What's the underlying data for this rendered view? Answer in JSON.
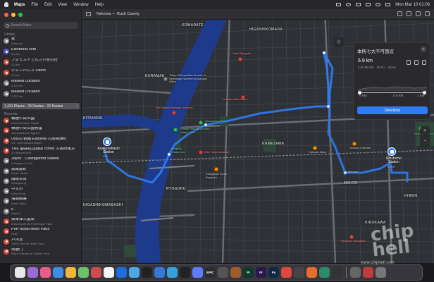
{
  "menubar": {
    "app": "Maps",
    "items": [
      "File",
      "Edit",
      "View",
      "Window",
      "Help"
    ],
    "clock": "Mon Mar 10  01:06"
  },
  "toolbar": {
    "title": "Nekoma — Rush County"
  },
  "sidebar": {
    "search_placeholder": "Search Maps",
    "library_heading": "Library",
    "library": [
      {
        "title": "家",
        "subtitle": "Close by",
        "color": "#8e8e93"
      },
      {
        "title": "Electronic Arts",
        "subtitle": "5.9 km",
        "color": "#5856d6"
      },
      {
        "title": "ブレミストでんざい宮の社",
        "subtitle": "2.2 km",
        "color": "#e0483e"
      },
      {
        "title": "グレンパレス Okino",
        "subtitle": "4.3 km",
        "color": "#e0483e"
      },
      {
        "title": "Marked Location",
        "subtitle": "2,226 km",
        "color": "#8e8e93"
      },
      {
        "title": "Marked Location",
        "subtitle": "2,225 km",
        "color": "#8e8e93"
      }
    ],
    "selected": "1,431 Places · 29 Routes · 22 Routes",
    "recents_heading": "Recents",
    "recents": [
      {
        "title": "模造中央公園",
        "subtitle": "Nekoma Ward, Osaka",
        "color": "#e0483e"
      },
      {
        "title": "模造中央公園预留",
        "subtitle": "Tachibanadori-Higashi",
        "color": "#e0483e"
      },
      {
        "title": "UN/20 數碼 Express-大阪梅澤町",
        "subtitle": "1-1, Umemitsuhonmachi",
        "color": "#e0483e"
      },
      {
        "title": "THE 最高在団酒店 comic 大阪府東京",
        "subtitle": "2-3 Marunouchi",
        "color": "#e0483e"
      },
      {
        "title": "Joyce · Collingwood Station",
        "subtitle": "Collingwood, VIC",
        "color": "#8e8e93"
      },
      {
        "title": "高尾尾町",
        "subtitle": "Ikeda, Osaka",
        "color": "#8e8e93"
      },
      {
        "title": "順德名合",
        "subtitle": "Guangdong",
        "color": "#8e8e93"
      },
      {
        "title": "中文市",
        "subtitle": "Hong Kong",
        "color": "#8e8e93"
      },
      {
        "title": "海城図書",
        "subtitle": "Kanto Ward",
        "color": "#8e8e93"
      },
      {
        "title": "6",
        "subtitle": "Ward 6",
        "color": "#8e8e93"
      },
      {
        "title": "巣栗津三国店",
        "subtitle": "8 Boulevard de Port-Royal, Paris",
        "color": "#e0483e"
      },
      {
        "title": "Port Royal Hotel Paris",
        "subtitle": "Paris",
        "color": "#e0483e"
      },
      {
        "title": "卢浮宫",
        "subtitle": "75001 Rue de Rivoli, Paris",
        "color": "#e0483e"
      },
      {
        "title": "凯旋门",
        "subtitle": "Place Charles de Gaulle, Paris",
        "color": "#e0483e"
      }
    ]
  },
  "map": {
    "districts": [
      "KOMADATE",
      "HIGASHIKOMADA",
      "KURAMAE",
      "KITAHIDAI",
      "KAMEZAWA",
      "MIDORI",
      "RYOGOKU",
      "HIGASHIKOMABASHI",
      "KIKUKAWA",
      "KINSHI"
    ],
    "places": [
      {
        "name": "Tokyo Metropolitan Bureau of Sewerage Northern Sewerage Office",
        "kind": "gray"
      },
      {
        "name": "The Sumida Hokusai Museum",
        "kind": "red"
      },
      {
        "name": "Former Yasuda Garden Water Gate",
        "kind": "green"
      },
      {
        "name": "Yokoamicho Park",
        "kind": "green"
      },
      {
        "name": "Ryogoku Sekaridome",
        "kind": "green"
      },
      {
        "name": "Edo-Tokyo Museum",
        "kind": "red"
      },
      {
        "name": "Kokugikan Sumo Ryogoku",
        "kind": "orange"
      },
      {
        "name": "RYOGOKU",
        "kind": "label"
      },
      {
        "name": "Hokusai Sabo",
        "kind": "orange"
      },
      {
        "name": "Sumida Chardan",
        "kind": "orange"
      },
      {
        "name": "Edo-Saaki Yokaichi",
        "kind": "red"
      },
      {
        "name": "Kinshicho Park",
        "kind": "green"
      },
      {
        "name": "Hotel Ryogoku",
        "kind": "red"
      },
      {
        "name": "Yamada Machidaya",
        "kind": "red"
      },
      {
        "name": "Kotobashi",
        "kind": "label"
      },
      {
        "name": "Kinshicho Ward",
        "kind": "label"
      },
      {
        "name": "Ryogoku Kokugikan",
        "kind": "red"
      }
    ],
    "start_station": {
      "name": "Asakusabashi Station",
      "tag": "END"
    },
    "end_station": {
      "name": "Kinshicho Station",
      "tag": "START"
    },
    "route_color": "#2f7cf6"
  },
  "directions_card": {
    "title": "本所七大不可思议",
    "distance": "5.9 km",
    "duration": "1 hr 25 min · 10 m↑ · 10 m↓",
    "km_start": "0 KM",
    "km_mid": "0.6 KM",
    "km_end": "1 KM",
    "button": "Directions"
  },
  "dock": {
    "apps": [
      {
        "label": "",
        "color": "#e8e8ec"
      },
      {
        "label": "",
        "color": "#9a6bd8"
      },
      {
        "label": "",
        "color": "#e85d8a"
      },
      {
        "label": "",
        "color": "#3a8ee6"
      },
      {
        "label": "",
        "color": "#f5b53b"
      },
      {
        "label": "",
        "color": "#6cc26c"
      },
      {
        "label": "",
        "color": "#d04c4c"
      },
      {
        "label": "10",
        "color": "#f4f4f4"
      },
      {
        "label": "",
        "color": "#1d6ddf"
      },
      {
        "label": "",
        "color": "#4ea8e8"
      },
      {
        "label": "",
        "color": "#222"
      },
      {
        "label": "",
        "color": "#3478d8"
      },
      {
        "label": "",
        "color": "#36a0e0"
      },
      {
        "label": "",
        "color": "#222"
      },
      {
        "label": "",
        "color": "#5c7cfa"
      },
      {
        "label": "EPIC",
        "color": "#2b2b2b"
      },
      {
        "label": "",
        "color": "#555"
      },
      {
        "label": "",
        "color": "#a05a2c"
      },
      {
        "label": "Pt",
        "color": "#0e3a2e"
      },
      {
        "label": "Pr",
        "color": "#2b1a49"
      },
      {
        "label": "Ps",
        "color": "#0b2a4a"
      },
      {
        "label": "",
        "color": "#e0483e"
      },
      {
        "label": "",
        "color": "#444"
      },
      {
        "label": "",
        "color": "#e66d2e"
      },
      {
        "label": "",
        "color": "#2a8a6a"
      },
      {
        "label": "",
        "color": "#333"
      },
      {
        "label": "",
        "color": "#666"
      },
      {
        "label": "",
        "color": "#c23b3b"
      },
      {
        "label": "",
        "color": "#777"
      }
    ]
  },
  "watermark": "www.chiphell.com",
  "watermark_logo": "chip hell"
}
